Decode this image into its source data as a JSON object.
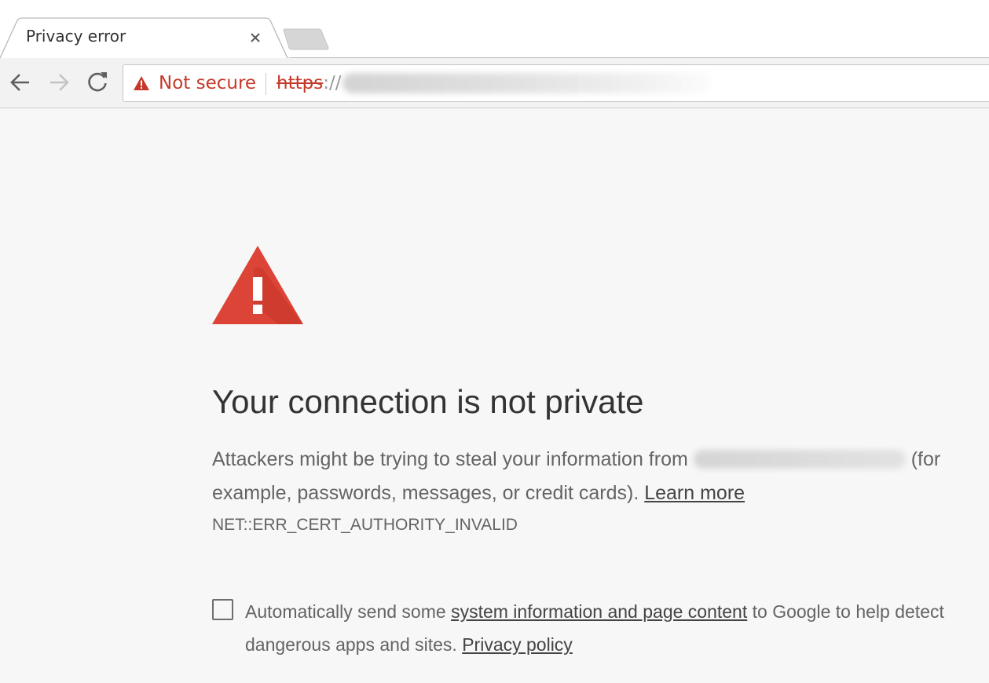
{
  "tab": {
    "title": "Privacy error",
    "close_icon": "close-icon",
    "new_tab_icon": "new-tab-icon"
  },
  "toolbar": {
    "back_icon": "back-arrow-icon",
    "forward_icon": "forward-arrow-icon",
    "reload_icon": "reload-icon",
    "security_label": "Not secure",
    "security_icon": "warning-triangle-icon",
    "url_scheme": "https",
    "url_separator": "://"
  },
  "page": {
    "icon": "warning-triangle-icon",
    "heading": "Your connection is not private",
    "explanation_before": "Attackers might be trying to steal your information from",
    "explanation_after": "(for example, passwords, messages, or credit cards).",
    "learn_more": "Learn more",
    "error_code": "NET::ERR_CERT_AUTHORITY_INVALID",
    "optin_before": "Automatically send some",
    "optin_link": "system information and page content",
    "optin_middle": "to Google to help detect dangerous apps and sites.",
    "privacy_link": "Privacy policy"
  },
  "colors": {
    "danger": "#c53929",
    "warning_icon": "#db4437",
    "page_background": "#f7f7f7",
    "body_text": "#646464"
  }
}
